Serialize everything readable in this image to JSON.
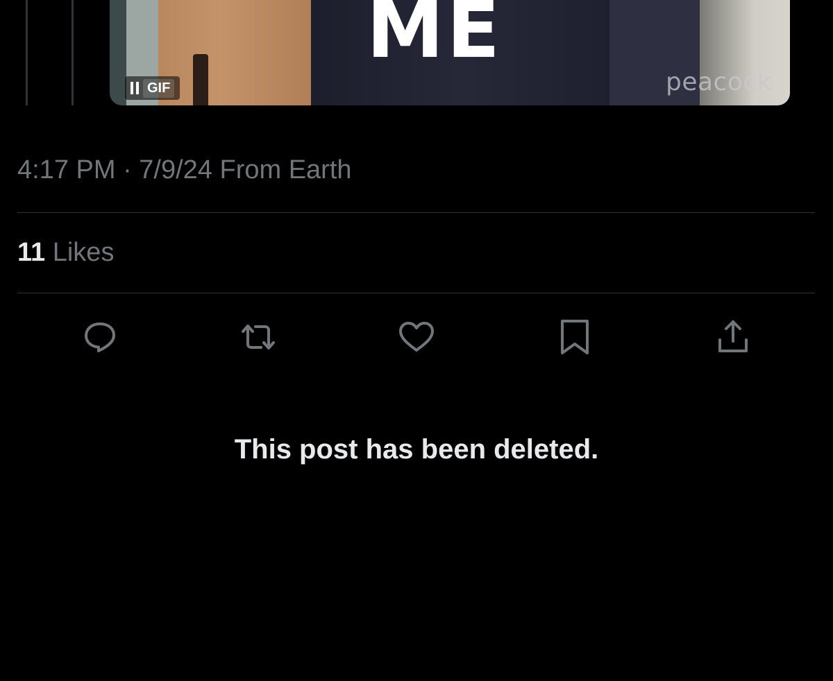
{
  "media": {
    "caption": "ME",
    "watermark": "peacock",
    "badge": {
      "pause_icon": "pause-icon",
      "label": "GIF"
    }
  },
  "post": {
    "timestamp": "4:17 PM · 7/9/24 From Earth",
    "likes": {
      "count": "11",
      "label": "Likes"
    }
  },
  "actions": [
    {
      "name": "reply",
      "icon": "reply-icon"
    },
    {
      "name": "repost",
      "icon": "repost-icon"
    },
    {
      "name": "like",
      "icon": "heart-icon"
    },
    {
      "name": "bookmark",
      "icon": "bookmark-icon"
    },
    {
      "name": "share",
      "icon": "share-icon"
    }
  ],
  "deleted_notice": "This post has been deleted.",
  "colors": {
    "background": "#000000",
    "text_primary": "#e7e9ea",
    "text_secondary": "#71767b",
    "divider": "#2f3336"
  }
}
